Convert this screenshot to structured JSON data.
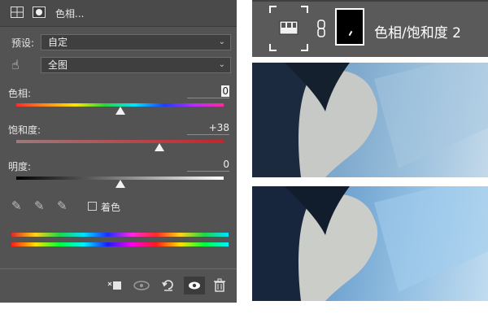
{
  "panel": {
    "title": "色相...",
    "preset_label": "预设:",
    "preset_value": "自定",
    "channel_value": "全图",
    "hue_label": "色相:",
    "hue_value": "0",
    "saturation_label": "饱和度:",
    "saturation_value": "+38",
    "lightness_label": "明度:",
    "lightness_value": "0",
    "colorize_label": "着色",
    "hue_level": 0,
    "saturation_level": 38,
    "lightness_level": 0
  },
  "footer": {
    "buttons": [
      "clip-to-layer-icon",
      "view-previous-icon",
      "reset-icon",
      "visibility-eye-icon",
      "trash-icon"
    ]
  },
  "layer": {
    "name": "色相/饱和度 2"
  },
  "colors": {
    "panel_bg": "#535353",
    "saturation_track": "#c8232a",
    "accent_white": "#ffffff"
  }
}
